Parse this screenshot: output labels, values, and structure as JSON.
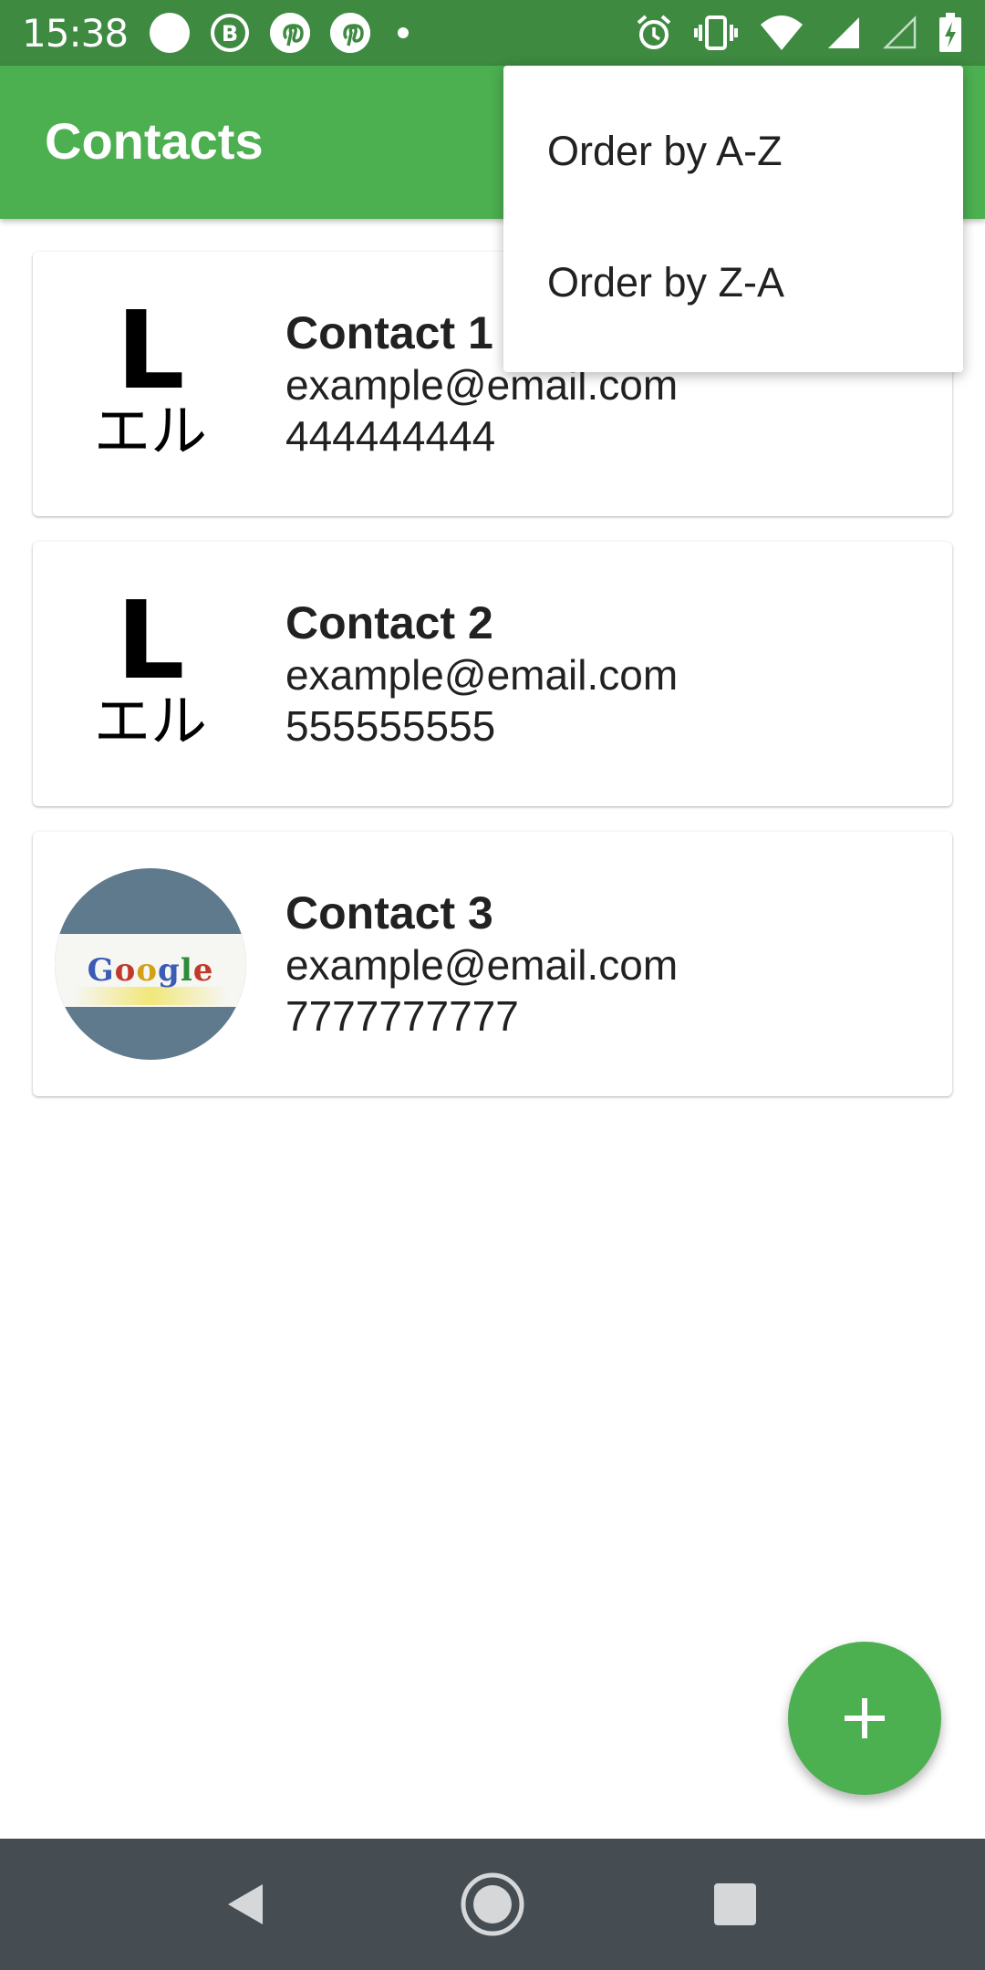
{
  "status_bar": {
    "time": "15:38",
    "notification_icons": [
      "whatsapp-icon",
      "b-icon",
      "pinterest-icon",
      "pinterest-icon"
    ],
    "b_icon_letter": "B",
    "right_icons": [
      "alarm-icon",
      "vibrate-icon",
      "wifi-icon",
      "signal-icon",
      "signal-empty-icon",
      "battery-charging-icon"
    ]
  },
  "app_bar": {
    "title": "Contacts"
  },
  "menu": {
    "items": [
      {
        "label": "Order by A-Z"
      },
      {
        "label": "Order by Z-A"
      }
    ]
  },
  "contacts": [
    {
      "name": "Contact 1",
      "email": "example@email.com",
      "phone": "444444444",
      "avatar_letter": "L",
      "avatar_kana": "エル"
    },
    {
      "name": "Contact 2",
      "email": "example@email.com",
      "phone": "555555555",
      "avatar_letter": "L",
      "avatar_kana": "エル"
    },
    {
      "name": "Contact 3",
      "email": "example@email.com",
      "phone": "7777777777",
      "avatar_logo": "Google"
    }
  ],
  "fab": {
    "icon": "plus-icon"
  },
  "nav_bar": {
    "icons": [
      "back-icon",
      "home-icon",
      "recents-icon"
    ]
  },
  "colors": {
    "primary": "#4caf50",
    "primary_dark": "#3d8a40",
    "nav_bar": "#454c52"
  }
}
